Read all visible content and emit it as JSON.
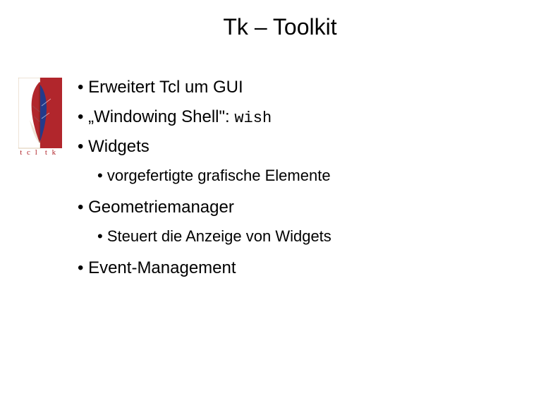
{
  "title": "Tk – Toolkit",
  "logo": {
    "label_left": "t c l",
    "label_right": "t k"
  },
  "bullets": {
    "b1": "Erweitert Tcl um GUI",
    "b2_prefix": "„Windowing Shell\": ",
    "b2_code": "wish",
    "b3": "Widgets",
    "b3_sub": "vorgefertigte  grafische Elemente",
    "b4": "Geometriemanager",
    "b4_sub": "Steuert die Anzeige von Widgets",
    "b5": "Event-Management"
  }
}
